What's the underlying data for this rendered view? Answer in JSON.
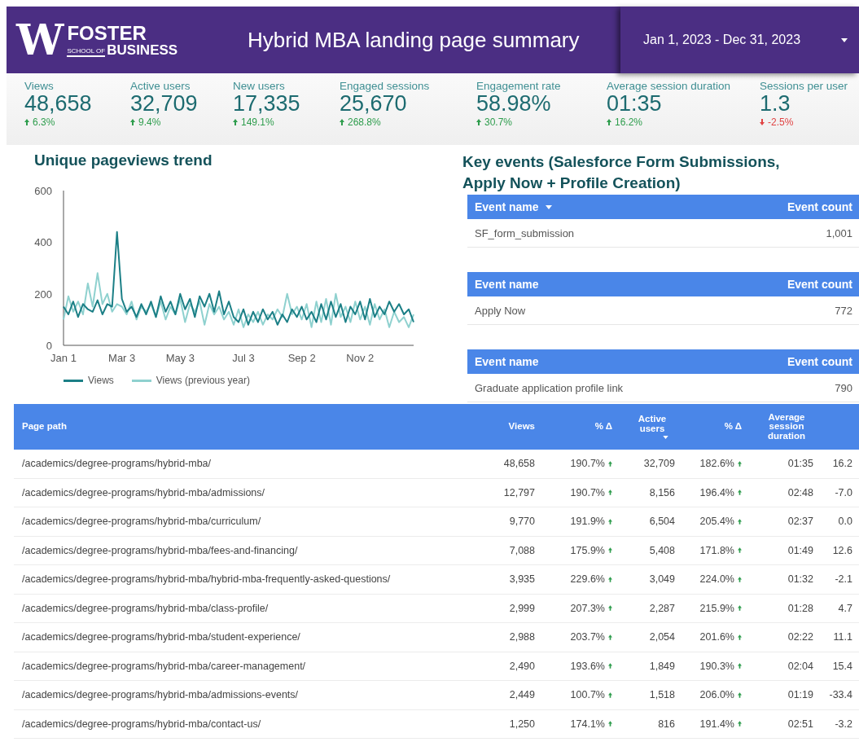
{
  "header": {
    "logo": {
      "letter": "W",
      "name": "FOSTER",
      "school_of": "SCHOOL OF",
      "business": "BUSINESS"
    },
    "title": "Hybrid MBA landing page summary",
    "date_range": "Jan 1, 2023 - Dec 31, 2023"
  },
  "kpis": [
    {
      "label": "Views",
      "value": "48,658",
      "change": "6.3%",
      "rising": true
    },
    {
      "label": "Active users",
      "value": "32,709",
      "change": "9.4%",
      "rising": true
    },
    {
      "label": "New users",
      "value": "17,335",
      "change": "149.1%",
      "rising": true
    },
    {
      "label": "Engaged sessions",
      "value": "25,670",
      "change": "268.8%",
      "rising": true
    },
    {
      "label": "Engagement rate",
      "value": "58.98%",
      "change": "30.7%",
      "rising": true
    },
    {
      "label": "Average session duration",
      "value": "01:35",
      "change": "16.2%",
      "rising": true
    },
    {
      "label": "Sessions per user",
      "value": "1.3",
      "change": "-2.5%",
      "rising": false
    }
  ],
  "trend_chart": {
    "title": "Unique pageviews trend",
    "chart_data": {
      "type": "line",
      "categories": [
        "Jan 1",
        null,
        null,
        null,
        null,
        null,
        null,
        null,
        null,
        null,
        null,
        null,
        "Mar 3",
        null,
        null,
        null,
        null,
        null,
        null,
        null,
        null,
        null,
        null,
        null,
        "May 3",
        null,
        null,
        null,
        null,
        null,
        null,
        null,
        null,
        null,
        null,
        null,
        null,
        "Jul 3",
        null,
        null,
        null,
        null,
        null,
        null,
        null,
        null,
        null,
        null,
        null,
        "Sep 2",
        null,
        null,
        null,
        null,
        null,
        null,
        null,
        null,
        null,
        null,
        null,
        "Nov 2",
        null,
        null,
        null,
        null,
        null,
        null,
        null,
        null,
        null,
        null,
        null
      ],
      "yticks": [
        0,
        200,
        400,
        600
      ],
      "ylim": [
        0,
        600
      ],
      "series": [
        {
          "name": "Views",
          "color": "#1b7f86",
          "values": [
            150,
            120,
            170,
            110,
            160,
            140,
            130,
            175,
            120,
            160,
            150,
            440,
            180,
            130,
            150,
            110,
            160,
            120,
            170,
            110,
            190,
            130,
            170,
            120,
            200,
            140,
            180,
            110,
            190,
            150,
            200,
            130,
            210,
            120,
            170,
            110,
            90,
            140,
            80,
            130,
            90,
            140,
            100,
            130,
            80,
            120,
            90,
            140,
            110,
            150,
            100,
            130,
            90,
            160,
            100,
            170,
            110,
            160,
            90,
            150,
            120,
            170,
            100,
            180,
            110,
            150,
            120,
            170,
            130,
            160,
            120,
            140,
            90
          ]
        },
        {
          "name": "Views (previous year)",
          "color": "#8fd1cf",
          "values": [
            100,
            190,
            130,
            170,
            120,
            240,
            150,
            280,
            160,
            200,
            130,
            160,
            150,
            120,
            170,
            100,
            150,
            130,
            160,
            110,
            170,
            100,
            150,
            120,
            180,
            90,
            160,
            130,
            170,
            80,
            160,
            120,
            150,
            100,
            130,
            80,
            140,
            70,
            120,
            90,
            130,
            80,
            120,
            100,
            140,
            110,
            200,
            120,
            150,
            100,
            160,
            70,
            170,
            90,
            180,
            80,
            200,
            110,
            150,
            90,
            170,
            100,
            150,
            80,
            160,
            100,
            140,
            70,
            130,
            90,
            110,
            70,
            120
          ]
        }
      ]
    }
  },
  "key_events": {
    "title": "Key events (Salesforce Form Submissions, Apply Now + Profile Creation)",
    "tables": [
      {
        "columns": [
          {
            "label": "Event name",
            "sorted": true
          },
          {
            "label": "Event count",
            "sorted": false
          }
        ],
        "rows": [
          {
            "name": "SF_form_submission",
            "count": "1,001"
          }
        ]
      },
      {
        "columns": [
          {
            "label": "Event name",
            "sorted": false
          },
          {
            "label": "Event count",
            "sorted": false
          }
        ],
        "rows": [
          {
            "name": "Apply Now",
            "count": "772"
          }
        ]
      },
      {
        "columns": [
          {
            "label": "Event name",
            "sorted": false
          },
          {
            "label": "Event count",
            "sorted": false
          }
        ],
        "rows": [
          {
            "name": "Graduate application profile link",
            "count": "790"
          }
        ]
      }
    ]
  },
  "pages_table": {
    "columns": [
      {
        "label": "Page path",
        "sorted": false
      },
      {
        "label": "Views",
        "sorted": false
      },
      {
        "label": "% Δ",
        "sorted": false
      },
      {
        "label": "Active users",
        "sorted": true
      },
      {
        "label": "% Δ",
        "sorted": false
      },
      {
        "label": "Average session duration",
        "sorted": false
      }
    ],
    "rows": [
      {
        "page_path": "/academics/degree-programs/hybrid-mba/",
        "views": "48,658",
        "views_change": {
          "value": "190.7%",
          "rising": true
        },
        "active_users": "32,709",
        "active_users_change": {
          "value": "182.6%",
          "rising": true
        },
        "avg_session_duration": "01:35",
        "column_7": "16.2"
      },
      {
        "page_path": "/academics/degree-programs/hybrid-mba/admissions/",
        "views": "12,797",
        "views_change": {
          "value": "190.7%",
          "rising": true
        },
        "active_users": "8,156",
        "active_users_change": {
          "value": "196.4%",
          "rising": true
        },
        "avg_session_duration": "02:48",
        "column_7": "-7.0"
      },
      {
        "page_path": "/academics/degree-programs/hybrid-mba/curriculum/",
        "views": "9,770",
        "views_change": {
          "value": "191.9%",
          "rising": true
        },
        "active_users": "6,504",
        "active_users_change": {
          "value": "205.4%",
          "rising": true
        },
        "avg_session_duration": "02:37",
        "column_7": "0.0"
      },
      {
        "page_path": "/academics/degree-programs/hybrid-mba/fees-and-financing/",
        "views": "7,088",
        "views_change": {
          "value": "175.9%",
          "rising": true
        },
        "active_users": "5,408",
        "active_users_change": {
          "value": "171.8%",
          "rising": true
        },
        "avg_session_duration": "01:49",
        "column_7": "12.6"
      },
      {
        "page_path": "/academics/degree-programs/hybrid-mba/hybrid-mba-frequently-asked-questions/",
        "views": "3,935",
        "views_change": {
          "value": "229.6%",
          "rising": true
        },
        "active_users": "3,049",
        "active_users_change": {
          "value": "224.0%",
          "rising": true
        },
        "avg_session_duration": "01:32",
        "column_7": "-2.1"
      },
      {
        "page_path": "/academics/degree-programs/hybrid-mba/class-profile/",
        "views": "2,999",
        "views_change": {
          "value": "207.3%",
          "rising": true
        },
        "active_users": "2,287",
        "active_users_change": {
          "value": "215.9%",
          "rising": true
        },
        "avg_session_duration": "01:28",
        "column_7": "4.7"
      },
      {
        "page_path": "/academics/degree-programs/hybrid-mba/student-experience/",
        "views": "2,988",
        "views_change": {
          "value": "203.7%",
          "rising": true
        },
        "active_users": "2,054",
        "active_users_change": {
          "value": "201.6%",
          "rising": true
        },
        "avg_session_duration": "02:22",
        "column_7": "11.1"
      },
      {
        "page_path": "/academics/degree-programs/hybrid-mba/career-management/",
        "views": "2,490",
        "views_change": {
          "value": "193.6%",
          "rising": true
        },
        "active_users": "1,849",
        "active_users_change": {
          "value": "190.3%",
          "rising": true
        },
        "avg_session_duration": "02:04",
        "column_7": "15.4"
      },
      {
        "page_path": "/academics/degree-programs/hybrid-mba/admissions-events/",
        "views": "2,449",
        "views_change": {
          "value": "100.7%",
          "rising": true
        },
        "active_users": "1,518",
        "active_users_change": {
          "value": "206.0%",
          "rising": true
        },
        "avg_session_duration": "01:19",
        "column_7": "-33.4"
      },
      {
        "page_path": "/academics/degree-programs/hybrid-mba/contact-us/",
        "views": "1,250",
        "views_change": {
          "value": "174.1%",
          "rising": true
        },
        "active_users": "816",
        "active_users_change": {
          "value": "191.4%",
          "rising": true
        },
        "avg_session_duration": "02:51",
        "column_7": "-3.2"
      }
    ]
  }
}
